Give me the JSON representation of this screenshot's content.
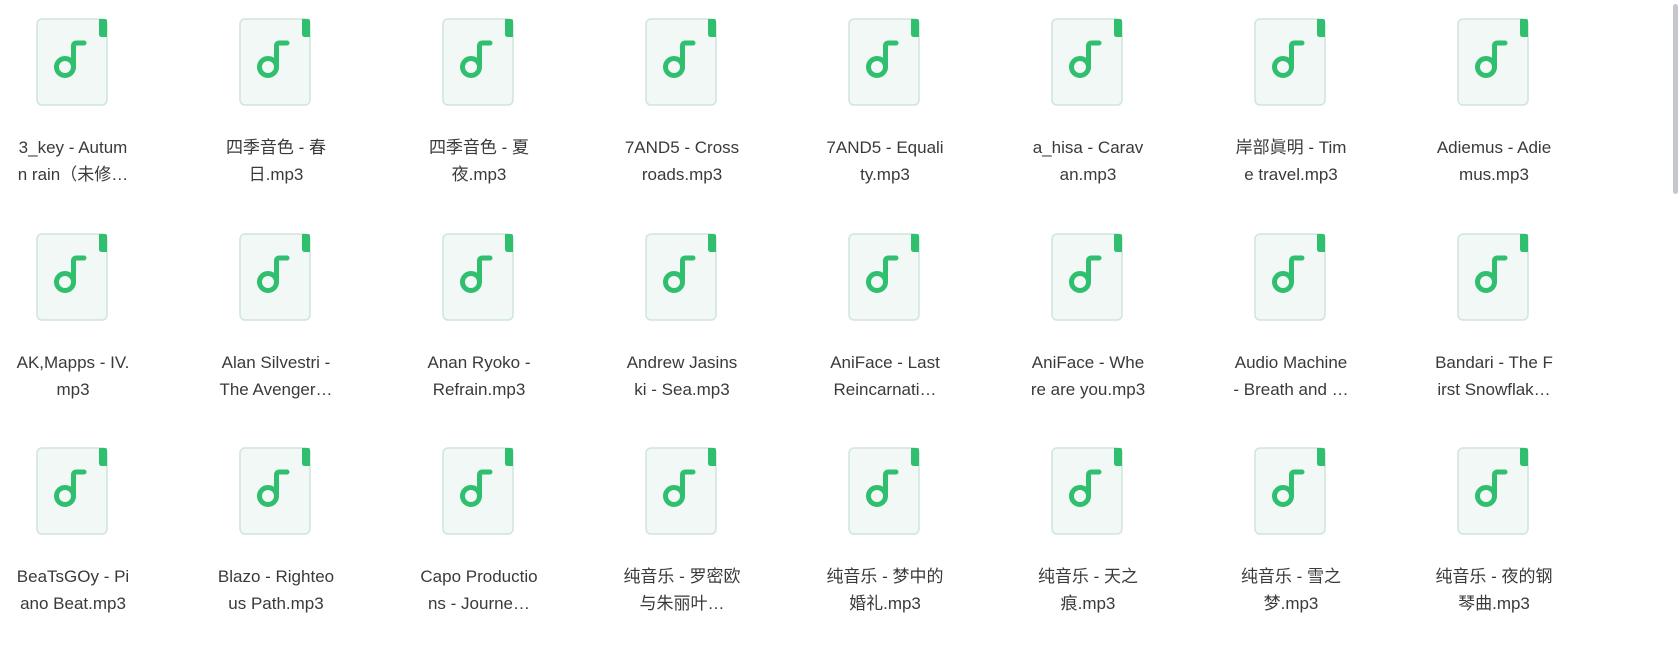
{
  "colors": {
    "icon_fill": "#f2f8f5",
    "icon_stroke": "#cfe6da",
    "icon_accent": "#2fbf6e",
    "text": "#3a3a3a"
  },
  "file_icon": "music-file-icon",
  "files": [
    {
      "name": "3_key - Autumn rain（未修…"
    },
    {
      "name": "四季音色 - 春日.mp3"
    },
    {
      "name": "四季音色 - 夏夜.mp3"
    },
    {
      "name": "7AND5 - Crossroads.mp3"
    },
    {
      "name": "7AND5 - Equality.mp3"
    },
    {
      "name": "a_hisa - Caravan.mp3"
    },
    {
      "name": "岸部眞明 - Time travel.mp3"
    },
    {
      "name": "Adiemus - Adiemus.mp3"
    },
    {
      "name": "AK,Mapps - IV.mp3"
    },
    {
      "name": "Alan Silvestri - The Avenger…"
    },
    {
      "name": "Anan Ryoko - Refrain.mp3"
    },
    {
      "name": "Andrew Jasinski - Sea.mp3"
    },
    {
      "name": "AniFace - Last Reincarnati…"
    },
    {
      "name": "AniFace - Where are you.mp3"
    },
    {
      "name": "Audio Machine - Breath and …"
    },
    {
      "name": "Bandari - The First Snowflak…"
    },
    {
      "name": "BeaTsGOy - Piano Beat.mp3"
    },
    {
      "name": "Blazo - Righteous Path.mp3"
    },
    {
      "name": "Capo Productions - Journe…"
    },
    {
      "name": "纯音乐 - 罗密欧与朱丽叶…"
    },
    {
      "name": "纯音乐 - 梦中的婚礼.mp3"
    },
    {
      "name": "纯音乐 - 天之痕.mp3"
    },
    {
      "name": "纯音乐 - 雪之梦.mp3"
    },
    {
      "name": "纯音乐 - 夜的钢琴曲.mp3"
    }
  ]
}
